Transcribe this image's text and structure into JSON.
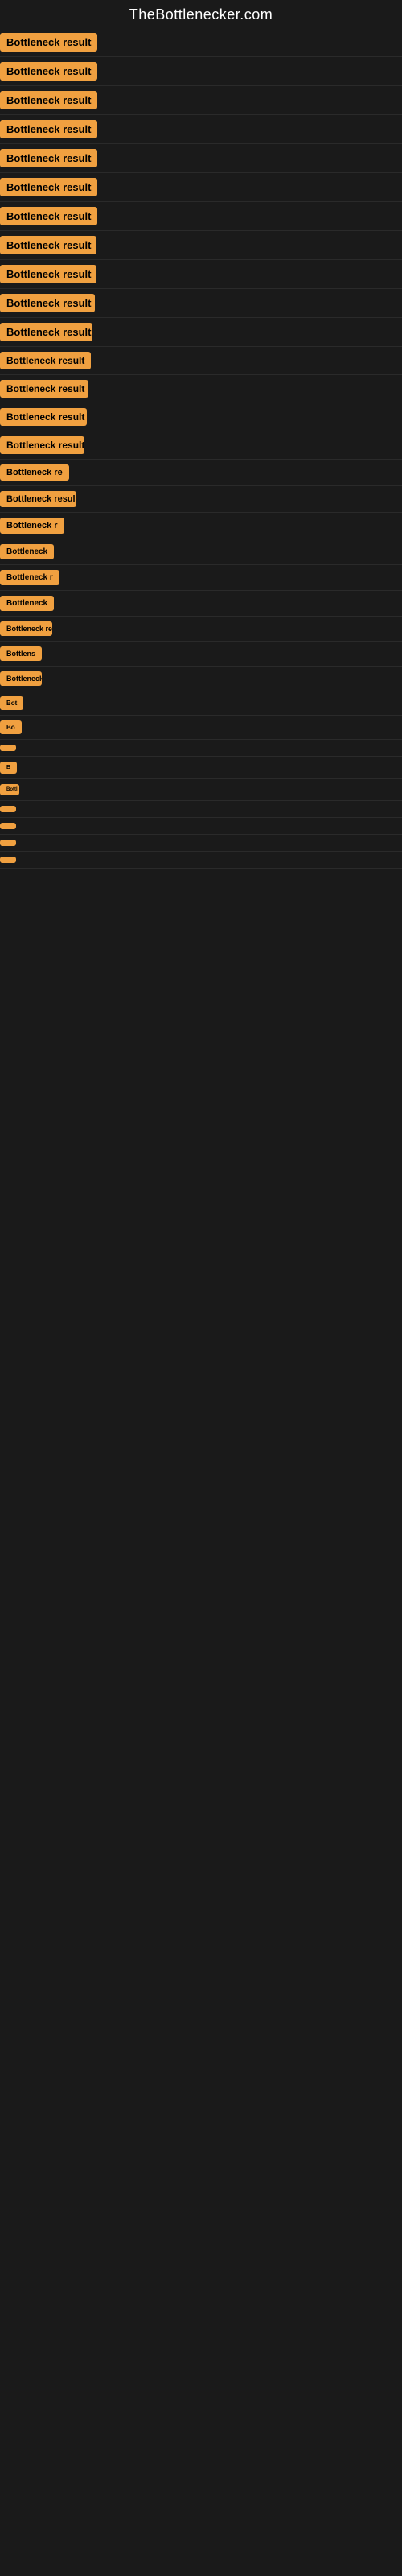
{
  "site": {
    "title": "TheBottlenecker.com"
  },
  "rows": [
    {
      "id": 1,
      "label": "Bottleneck result"
    },
    {
      "id": 2,
      "label": "Bottleneck result"
    },
    {
      "id": 3,
      "label": "Bottleneck result"
    },
    {
      "id": 4,
      "label": "Bottleneck result"
    },
    {
      "id": 5,
      "label": "Bottleneck result"
    },
    {
      "id": 6,
      "label": "Bottleneck result"
    },
    {
      "id": 7,
      "label": "Bottleneck result"
    },
    {
      "id": 8,
      "label": "Bottleneck result"
    },
    {
      "id": 9,
      "label": "Bottleneck result"
    },
    {
      "id": 10,
      "label": "Bottleneck result"
    },
    {
      "id": 11,
      "label": "Bottleneck result"
    },
    {
      "id": 12,
      "label": "Bottleneck result"
    },
    {
      "id": 13,
      "label": "Bottleneck result"
    },
    {
      "id": 14,
      "label": "Bottleneck result"
    },
    {
      "id": 15,
      "label": "Bottleneck result"
    },
    {
      "id": 16,
      "label": "Bottleneck re"
    },
    {
      "id": 17,
      "label": "Bottleneck result"
    },
    {
      "id": 18,
      "label": "Bottleneck r"
    },
    {
      "id": 19,
      "label": "Bottleneck"
    },
    {
      "id": 20,
      "label": "Bottleneck r"
    },
    {
      "id": 21,
      "label": "Bottleneck"
    },
    {
      "id": 22,
      "label": "Bottleneck res"
    },
    {
      "id": 23,
      "label": "Bottlens"
    },
    {
      "id": 24,
      "label": "Bottleneck"
    },
    {
      "id": 25,
      "label": "Bot"
    },
    {
      "id": 26,
      "label": "Bo"
    },
    {
      "id": 27,
      "label": ""
    },
    {
      "id": 28,
      "label": "B"
    },
    {
      "id": 29,
      "label": "Bottl"
    },
    {
      "id": 30,
      "label": ""
    },
    {
      "id": 31,
      "label": ""
    },
    {
      "id": 32,
      "label": ""
    },
    {
      "id": 33,
      "label": ""
    }
  ]
}
